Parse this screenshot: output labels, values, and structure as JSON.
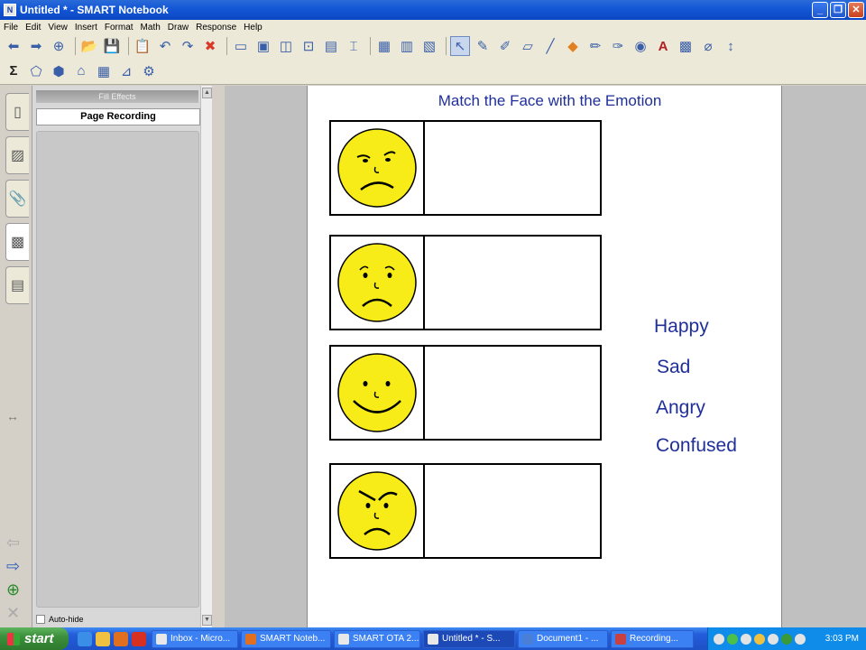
{
  "window": {
    "title": "Untitled * - SMART Notebook"
  },
  "menu": [
    "File",
    "Edit",
    "View",
    "Insert",
    "Format",
    "Math",
    "Draw",
    "Response",
    "Help"
  ],
  "toolbar_icons_row1": [
    "back-icon",
    "forward-icon",
    "add-page-icon",
    "open-icon",
    "save-icon",
    "paste-icon",
    "undo-icon",
    "redo-icon",
    "delete-icon",
    "screen-shade-icon",
    "full-screen-icon",
    "dual-page-icon",
    "capture-icon",
    "document-camera-icon",
    "table-icon",
    "insert-icon",
    "properties-icon",
    "select-icon",
    "pen-icon",
    "creative-pen-icon",
    "eraser-icon",
    "line-icon",
    "shape-icon",
    "magic-pen-icon",
    "recognition-pen-icon",
    "fill-icon",
    "text-icon",
    "gallery-icon",
    "measure-icon",
    "move-toolbar-icon"
  ],
  "toolbar_icons_row2": [
    "sigma-icon",
    "shape-fill-icon",
    "3d-icon",
    "compass-icon",
    "table-tool-icon",
    "graph-icon",
    "tools-icon"
  ],
  "sidepanel": {
    "header": "Fill Effects",
    "button": "Page Recording",
    "autohide_label": "Auto-hide"
  },
  "canvas": {
    "title": "Match the Face with the Emotion",
    "faces": [
      "confused",
      "sad",
      "happy",
      "angry"
    ],
    "emotions": [
      "Happy",
      "Sad",
      "Angry",
      "Confused"
    ]
  },
  "taskbar": {
    "start_label": "start",
    "tasks": [
      "Inbox - Micro...",
      "SMART Noteb...",
      "SMART OTA 2...",
      "Untitled * - S...",
      "Document1 - ...",
      "Recording..."
    ],
    "clock": "3:03 PM"
  },
  "colors": {
    "title_bar": "#0a46c4",
    "face_fill": "#f7ec17",
    "text_blue": "#1f2f9a"
  }
}
